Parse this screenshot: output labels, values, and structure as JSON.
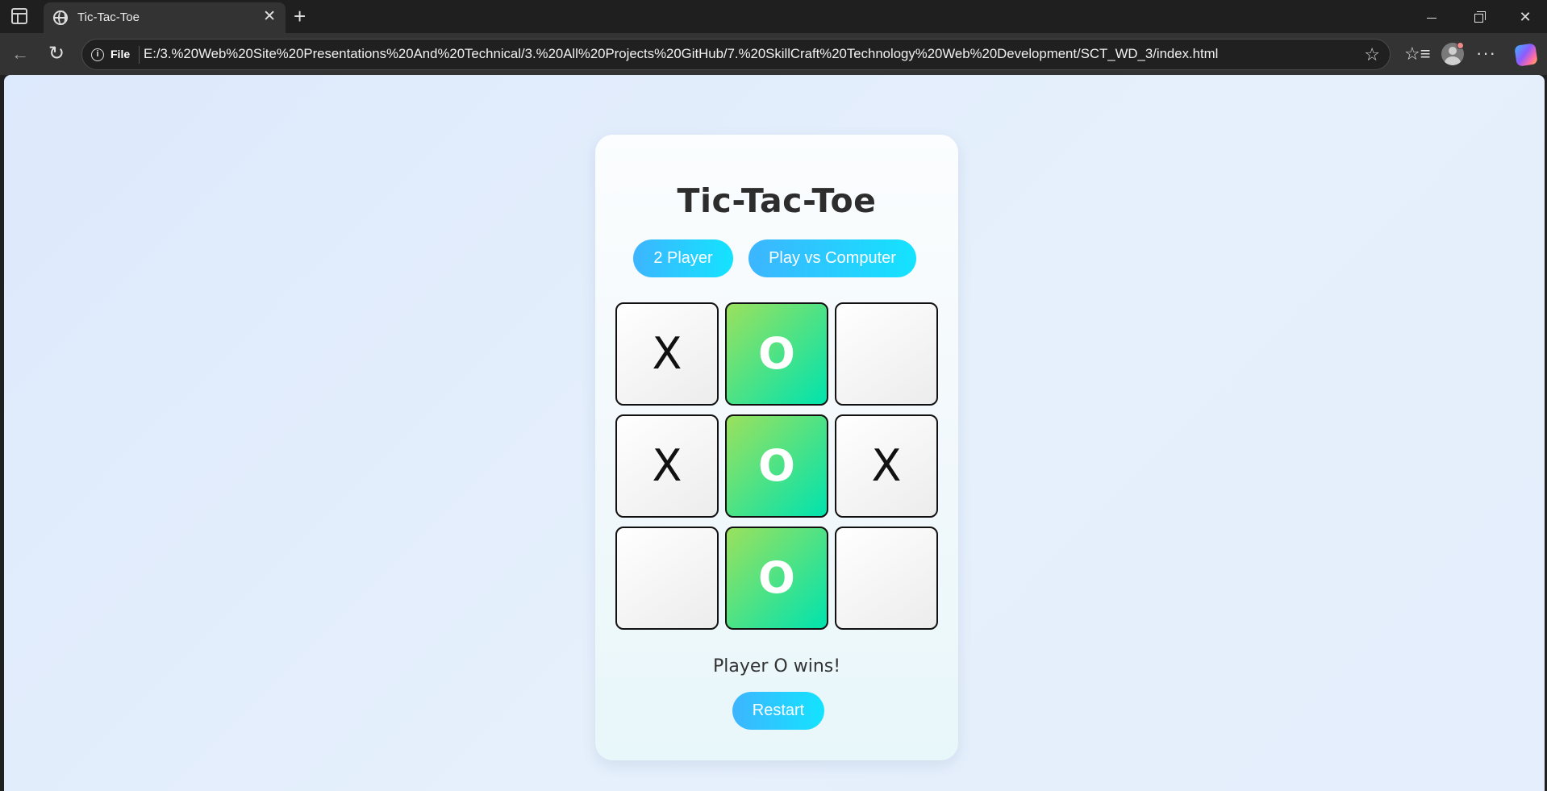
{
  "browser": {
    "tab_title": "Tic-Tac-Toe",
    "tab_close": "✕",
    "new_tab": "+",
    "address": {
      "scheme_label": "File",
      "url": "E:/3.%20Web%20Site%20Presentations%20And%20Technical/3.%20All%20Projects%20GitHub/7.%20SkillCraft%20Technology%20Web%20Development/SCT_WD_3/index.html"
    },
    "icons": {
      "back": "←",
      "reload": "↻",
      "info": "i",
      "favorite": "☆",
      "favorites": "☆≡",
      "more": "···",
      "close_window": "✕"
    }
  },
  "game": {
    "title": "Tic-Tac-Toe",
    "mode_buttons": {
      "two_player": "2 Player",
      "vs_computer": "Play vs Computer"
    },
    "board": [
      "X",
      "O",
      "",
      "X",
      "O",
      "X",
      "",
      "O",
      ""
    ],
    "winning_cells": [
      1,
      4,
      7
    ],
    "status": "Player O wins!",
    "restart_label": "Restart",
    "colors": {
      "button_gradient_start": "#3db5ff",
      "button_gradient_end": "#14e3ff",
      "win_gradient_start": "#9be15d",
      "win_gradient_end": "#00e3ae"
    }
  }
}
